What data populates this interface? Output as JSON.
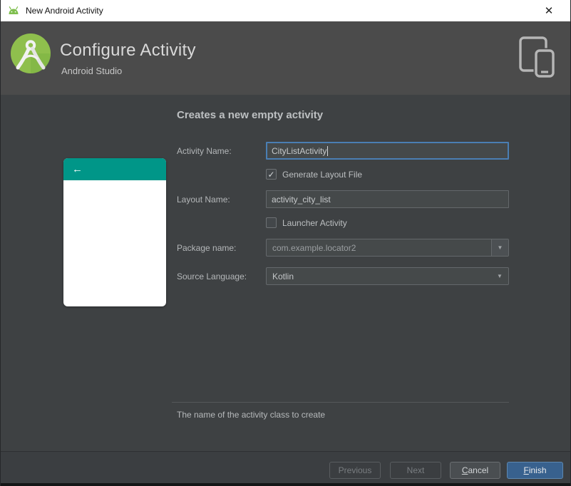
{
  "window": {
    "title": "New Android Activity",
    "close_glyph": "✕"
  },
  "header": {
    "title": "Configure Activity",
    "subtitle": "Android Studio"
  },
  "content": {
    "heading": "Creates a new empty activity",
    "form": {
      "activity_name_label": "Activity Name:",
      "activity_name_value": "CityListActivity",
      "generate_layout_label": "Generate Layout File",
      "generate_layout_checked": true,
      "layout_name_label": "Layout Name:",
      "layout_name_value": "activity_city_list",
      "launcher_label": "Launcher Activity",
      "launcher_checked": false,
      "package_label": "Package name:",
      "package_value": "com.example.locator2",
      "language_label": "Source Language:",
      "language_value": "Kotlin"
    },
    "status_text": "The name of the activity class to create"
  },
  "footer": {
    "previous_label": "Previous",
    "next_label": "Next",
    "cancel_label": "Cancel",
    "finish_label": "Finish"
  },
  "icons": {
    "back": "←",
    "check": "✓",
    "dropdown": "▼"
  },
  "colors": {
    "accent_teal": "#009688",
    "focus_blue": "#4a7eb3",
    "primary_button": "#38618e",
    "android_green": "#8fbf4d",
    "header_bg": "#4b4b4b",
    "content_bg": "#3e4143"
  }
}
